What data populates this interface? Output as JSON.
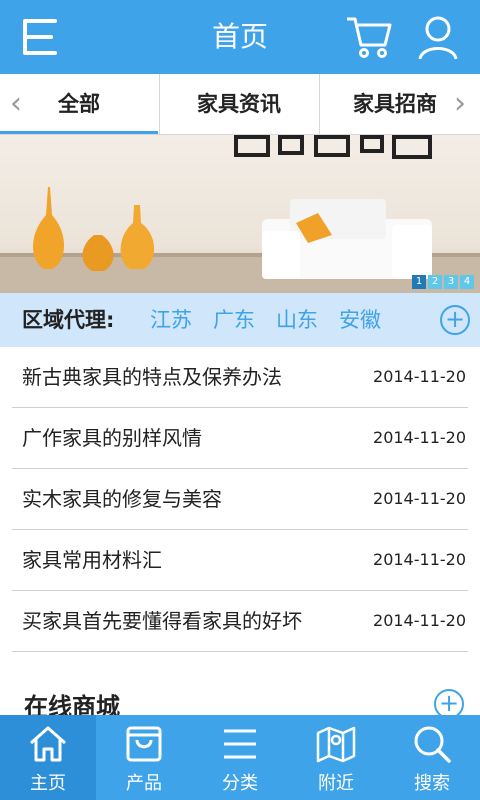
{
  "header": {
    "title": "首页"
  },
  "tabs": {
    "items": [
      "全部",
      "家具资讯",
      "家具招商"
    ]
  },
  "banner": {
    "pages": [
      "1",
      "2",
      "3",
      "4"
    ],
    "current_page": 1
  },
  "region": {
    "label": "区域代理:",
    "provinces": [
      "江苏",
      "广东",
      "山东",
      "安徽"
    ]
  },
  "news": [
    {
      "title": "新古典家具的特点及保养办法",
      "date": "2014-11-20"
    },
    {
      "title": "广作家具的别样风情",
      "date": "2014-11-20"
    },
    {
      "title": "实木家具的修复与美容",
      "date": "2014-11-20"
    },
    {
      "title": "家具常用材料汇",
      "date": "2014-11-20"
    },
    {
      "title": "买家具首先要懂得看家具的好坏",
      "date": "2014-11-20"
    }
  ],
  "section": {
    "title": "在线商城"
  },
  "bottom_nav": {
    "items": [
      "主页",
      "产品",
      "分类",
      "附近",
      "搜索"
    ],
    "active": 0
  },
  "colors": {
    "primary": "#3fa3ea",
    "region_bg": "#cfe6fb"
  }
}
